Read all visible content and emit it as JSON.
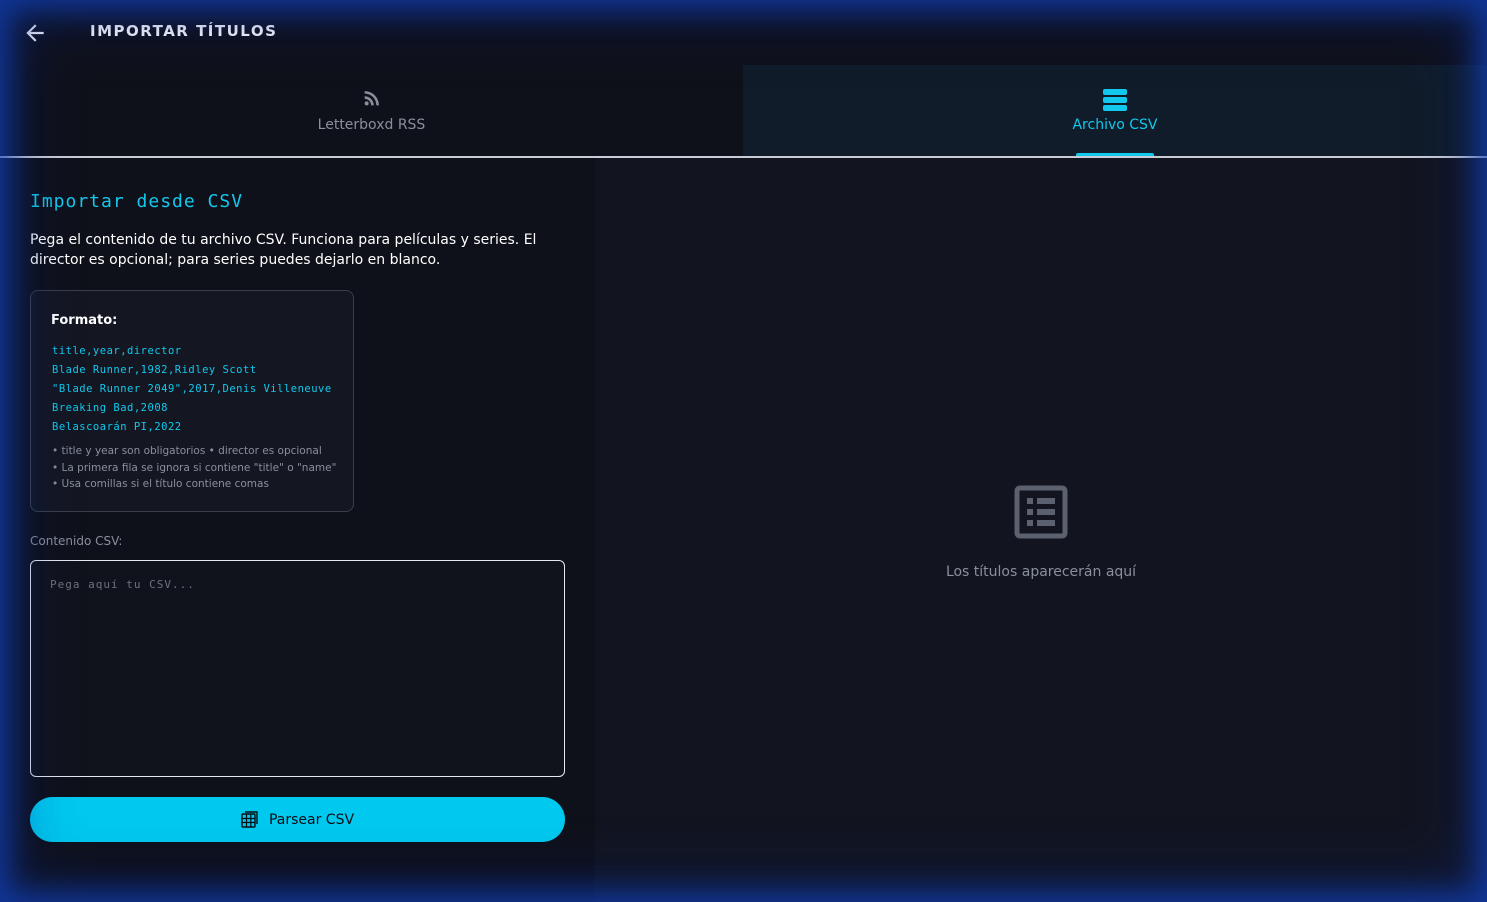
{
  "header": {
    "title": "IMPORTAR TÍTULOS"
  },
  "tabs": [
    {
      "label": "Letterboxd RSS",
      "icon": "rss-icon",
      "active": false
    },
    {
      "label": "Archivo CSV",
      "icon": "list-icon",
      "active": true
    }
  ],
  "colors": {
    "accent": "#12c8ec",
    "button": "#00c9ef",
    "background": "#0f111a"
  },
  "csv": {
    "section_title": "Importar desde CSV",
    "description": "Pega el contenido de tu archivo CSV. Funciona para películas y series. El director es opcional; para series puedes dejarlo en blanco.",
    "format_label": "Formato:",
    "example_lines": [
      "title,year,director",
      "Blade Runner,1982,Ridley Scott",
      "\"Blade Runner 2049\",2017,Denis Villeneuve",
      "Breaking Bad,2008",
      "Belascoarán PI,2022"
    ],
    "notes": [
      "• title y year son obligatorios  •  director es opcional",
      "• La primera fila se ignora si contiene \"title\" o \"name\"",
      "• Usa comillas si el título contiene comas"
    ],
    "input_label": "Contenido CSV:",
    "input_placeholder": "Pega aquí tu CSV...",
    "input_value": "",
    "parse_button": "Parsear CSV"
  },
  "results": {
    "empty_text": "Los títulos aparecerán aquí",
    "empty_icon": "list-alt-icon"
  }
}
